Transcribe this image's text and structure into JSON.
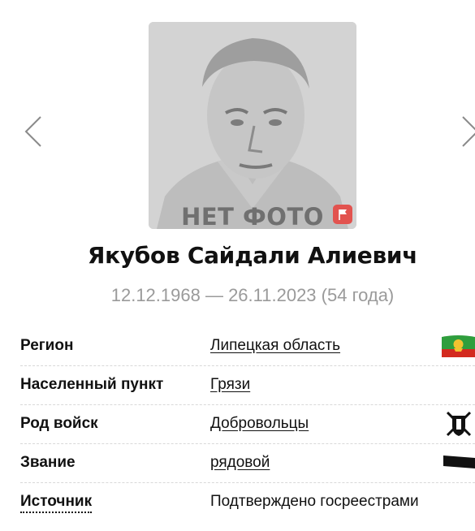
{
  "photo": {
    "caption": "НЕТ ФОТО"
  },
  "person": {
    "name": "Якубов Сайдали Алиевич",
    "dates": "12.12.1968 — 26.11.2023 (54 года)"
  },
  "info": {
    "rows": [
      {
        "label": "Регион",
        "value": "Липецкая область"
      },
      {
        "label": "Населенный пункт",
        "value": "Грязи"
      },
      {
        "label": "Род войск",
        "value": "Добровольцы"
      },
      {
        "label": "Звание",
        "value": "рядовой"
      },
      {
        "label": "Источник",
        "value": "Подтверждено госреестрами"
      }
    ]
  },
  "icons": {
    "prev": "chevron-left-icon",
    "next": "chevron-right-icon",
    "report": "flag-icon",
    "region": "region-emblem-icon",
    "troops": "volunteers-emblem-icon",
    "rank": "rank-insignia-icon"
  },
  "colors": {
    "accent_red": "#e2534f",
    "dates_gray": "#9a9a9a",
    "emblem_green": "#2f9e3d",
    "emblem_red": "#d32a1f"
  }
}
